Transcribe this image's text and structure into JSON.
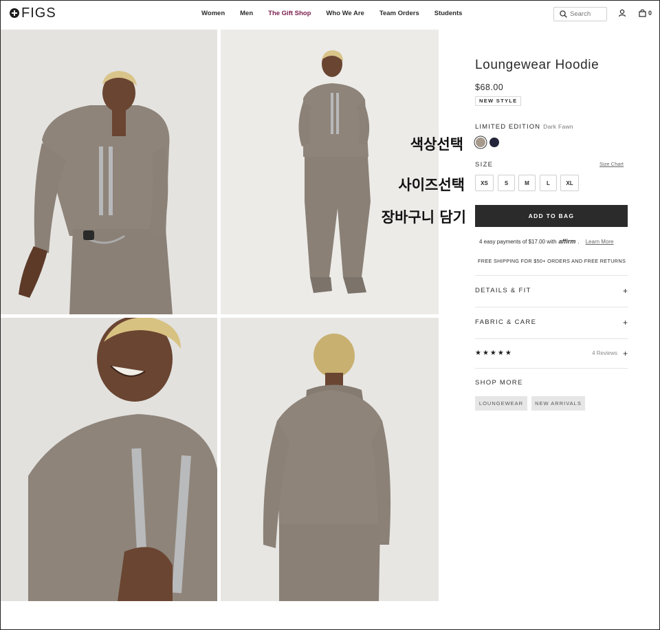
{
  "header": {
    "logo": "FIGS",
    "nav": [
      "Women",
      "Men",
      "The Gift Shop",
      "Who We Are",
      "Team Orders",
      "Students"
    ],
    "search_placeholder": "Search",
    "bag_count": "0",
    "accent_color": "#7a1c4d"
  },
  "product": {
    "title": "Loungewear Hoodie",
    "price": "$68.00",
    "badge": "NEW STYLE",
    "color_label": "LIMITED EDITION",
    "color_name": "Dark Fawn",
    "swatches": [
      {
        "name": "Dark Fawn",
        "hex": "#a59a8c",
        "selected": true
      },
      {
        "name": "Navy",
        "hex": "#23263a",
        "selected": false
      }
    ],
    "size_label": "SIZE",
    "size_chart": "Size Chart",
    "sizes": [
      "XS",
      "S",
      "M",
      "L",
      "XL"
    ],
    "add_to_bag": "ADD TO BAG",
    "affirm_text": "4 easy payments of $17.00 with",
    "affirm_brand": "affirm",
    "affirm_learn": "Learn More",
    "shipping": "FREE SHIPPING FOR $50+ ORDERS AND FREE RETURNS",
    "details_fit": "DETAILS & FIT",
    "fabric_care": "FABRIC & CARE",
    "stars": "★★★★★",
    "reviews": "4 Reviews",
    "shop_more": "SHOP MORE",
    "tags": [
      "LOUNGEWEAR",
      "NEW ARRIVALS"
    ]
  },
  "annotations": {
    "color_select": "색상선택",
    "size_select": "사이즈선택",
    "add_cart": "장바구니 담기"
  }
}
